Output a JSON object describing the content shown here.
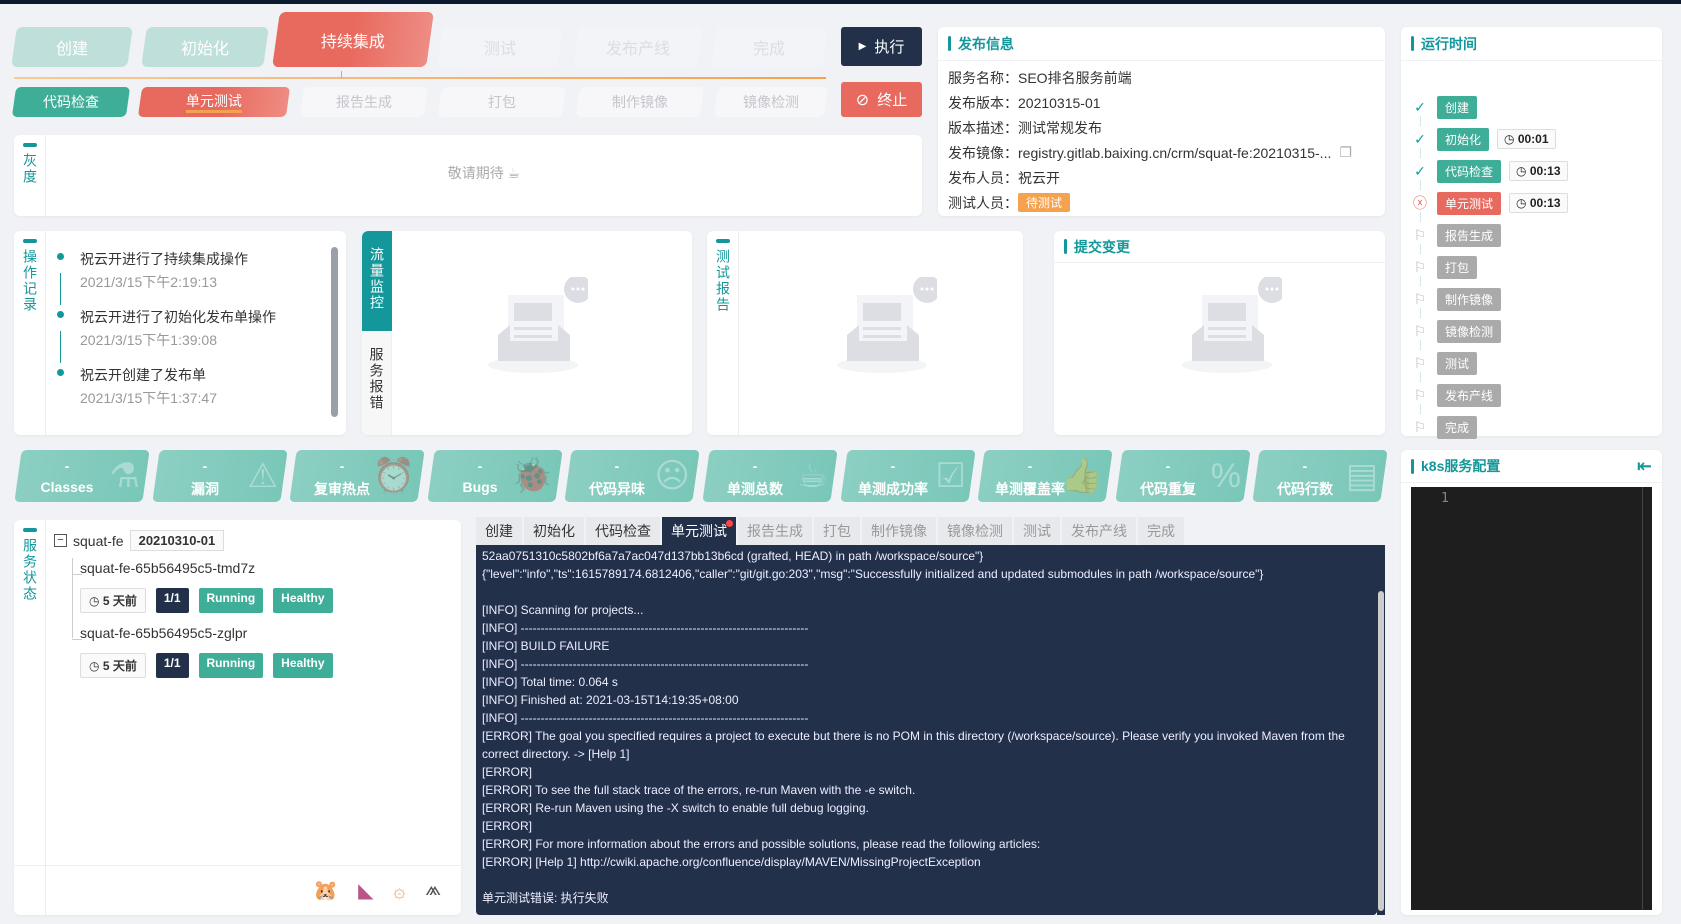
{
  "stages": [
    {
      "label": "创建",
      "state": "done"
    },
    {
      "label": "初始化",
      "state": "done"
    },
    {
      "label": "持续集成",
      "state": "active"
    },
    {
      "label": "测试",
      "state": "todo"
    },
    {
      "label": "发布产线",
      "state": "todo"
    },
    {
      "label": "完成",
      "state": "todo"
    }
  ],
  "substages": [
    {
      "label": "代码检查",
      "state": "done"
    },
    {
      "label": "单元测试",
      "state": "active"
    },
    {
      "label": "报告生成",
      "state": "todo"
    },
    {
      "label": "打包",
      "state": "todo"
    },
    {
      "label": "制作镜像",
      "state": "todo"
    },
    {
      "label": "镜像检测",
      "state": "todo"
    }
  ],
  "actions": {
    "execute": "执行",
    "stop": "终止"
  },
  "gray": {
    "title": "灰度",
    "placeholder": "敬请期待"
  },
  "release_info": {
    "title": "发布信息",
    "rows": [
      {
        "label": "服务名称：",
        "value": "SEO排名服务前端"
      },
      {
        "label": "发布版本：",
        "value": "20210315-01"
      },
      {
        "label": "版本描述：",
        "value": "测试常规发布"
      },
      {
        "label": "发布镜像：",
        "value": "registry.gitlab.baixing.cn/crm/squat-fe:20210315-..."
      },
      {
        "label": "发布人员：",
        "value": "祝云开"
      },
      {
        "label": "测试人员：",
        "value": "待测试"
      }
    ]
  },
  "runtime": {
    "title": "运行时间",
    "items": [
      {
        "label": "创建",
        "status": "done",
        "time": ""
      },
      {
        "label": "初始化",
        "status": "done",
        "time": "00:01"
      },
      {
        "label": "代码检查",
        "status": "done",
        "time": "00:13"
      },
      {
        "label": "单元测试",
        "status": "failed",
        "time": "00:13"
      },
      {
        "label": "报告生成",
        "status": "pending",
        "time": ""
      },
      {
        "label": "打包",
        "status": "pending",
        "time": ""
      },
      {
        "label": "制作镜像",
        "status": "pending",
        "time": ""
      },
      {
        "label": "镜像检测",
        "status": "pending",
        "time": ""
      },
      {
        "label": "测试",
        "status": "pending",
        "time": ""
      },
      {
        "label": "发布产线",
        "status": "pending",
        "time": ""
      },
      {
        "label": "完成",
        "status": "pending",
        "time": ""
      }
    ]
  },
  "operations": {
    "title": "操作记录",
    "items": [
      {
        "text": "祝云开进行了持续集成操作",
        "time": "2021/3/15下午2:19:13"
      },
      {
        "text": "祝云开进行了初始化发布单操作",
        "time": "2021/3/15下午1:39:08"
      },
      {
        "text": "祝云开创建了发布单",
        "time": "2021/3/15下午1:37:47"
      }
    ]
  },
  "monitor": {
    "tabs": [
      "流量监控",
      "服务报错"
    ],
    "active": 0
  },
  "test_report": {
    "title": "测试报告"
  },
  "commits": {
    "title": "提交变更"
  },
  "metrics": [
    {
      "label": "Classes",
      "value": "-",
      "icon": "flask-icon"
    },
    {
      "label": "漏洞",
      "value": "-",
      "icon": "warning-icon"
    },
    {
      "label": "复审热点",
      "value": "-",
      "icon": "alarm-icon"
    },
    {
      "label": "Bugs",
      "value": "-",
      "icon": "bug-icon"
    },
    {
      "label": "代码异味",
      "value": "-",
      "icon": "sad-face-icon"
    },
    {
      "label": "单测总数",
      "value": "-",
      "icon": "cup-icon"
    },
    {
      "label": "单测成功率",
      "value": "-",
      "icon": "checklist-icon"
    },
    {
      "label": "单测覆盖率",
      "value": "-",
      "icon": "thumbs-up-icon"
    },
    {
      "label": "代码重复",
      "value": "-",
      "icon": "percent-icon"
    },
    {
      "label": "代码行数",
      "value": "-",
      "icon": "document-icon"
    }
  ],
  "k8s": {
    "title": "k8s服务配置",
    "line_number": "1"
  },
  "service_status": {
    "title": "服务状态",
    "service": "squat-fe",
    "version": "20210310-01",
    "pods": [
      {
        "name": "squat-fe-65b56495c5-tmd7z",
        "age": "5 天前",
        "ready": "1/1",
        "phase": "Running",
        "health": "Healthy"
      },
      {
        "name": "squat-fe-65b56495c5-zglpr",
        "age": "5 天前",
        "ready": "1/1",
        "phase": "Running",
        "health": "Healthy"
      }
    ]
  },
  "log": {
    "tabs": [
      {
        "label": "创建",
        "state": "done"
      },
      {
        "label": "初始化",
        "state": "done"
      },
      {
        "label": "代码检查",
        "state": "done"
      },
      {
        "label": "单元测试",
        "state": "active"
      },
      {
        "label": "报告生成",
        "state": "todo"
      },
      {
        "label": "打包",
        "state": "todo"
      },
      {
        "label": "制作镜像",
        "state": "todo"
      },
      {
        "label": "镜像检测",
        "state": "todo"
      },
      {
        "label": "测试",
        "state": "todo"
      },
      {
        "label": "发布产线",
        "state": "todo"
      },
      {
        "label": "完成",
        "state": "todo"
      }
    ],
    "lines": [
      "52aa0751310c5802bf6a7a7ac047d137bb13b6cd (grafted, HEAD) in path /workspace/source\"}",
      "{\"level\":\"info\",\"ts\":1615789174.6812406,\"caller\":\"git/git.go:203\",\"msg\":\"Successfully initialized and updated submodules in path /workspace/source\"}",
      "",
      "[INFO] Scanning for projects...",
      "[INFO] ------------------------------------------------------------------------",
      "[INFO] BUILD FAILURE",
      "[INFO] ------------------------------------------------------------------------",
      "[INFO] Total time: 0.064 s",
      "[INFO] Finished at: 2021-03-15T14:19:35+08:00",
      "[INFO] ------------------------------------------------------------------------",
      "[ERROR] The goal you specified requires a project to execute but there is no POM in this directory (/workspace/source). Please verify you invoked Maven from the correct directory. -> [Help 1]",
      "[ERROR]",
      "[ERROR] To see the full stack trace of the errors, re-run Maven with the -e switch.",
      "[ERROR] Re-run Maven using the -X switch to enable full debug logging.",
      "[ERROR]",
      "[ERROR] For more information about the errors and possible solutions, please read the following articles:",
      "[ERROR] [Help 1] http://cwiki.apache.org/confluence/display/MAVEN/MissingProjectException",
      "",
      "单元测试错误: 执行失败"
    ]
  },
  "tools": [
    "gopher-icon",
    "kibana-icon",
    "grafana-icon",
    "sentry-icon"
  ],
  "colors": {
    "teal": "#14979a",
    "green": "#3fae99",
    "red": "#e86a5f",
    "navy": "#22304a",
    "orange": "#f5a24e",
    "gray": "#aaaaaa"
  }
}
